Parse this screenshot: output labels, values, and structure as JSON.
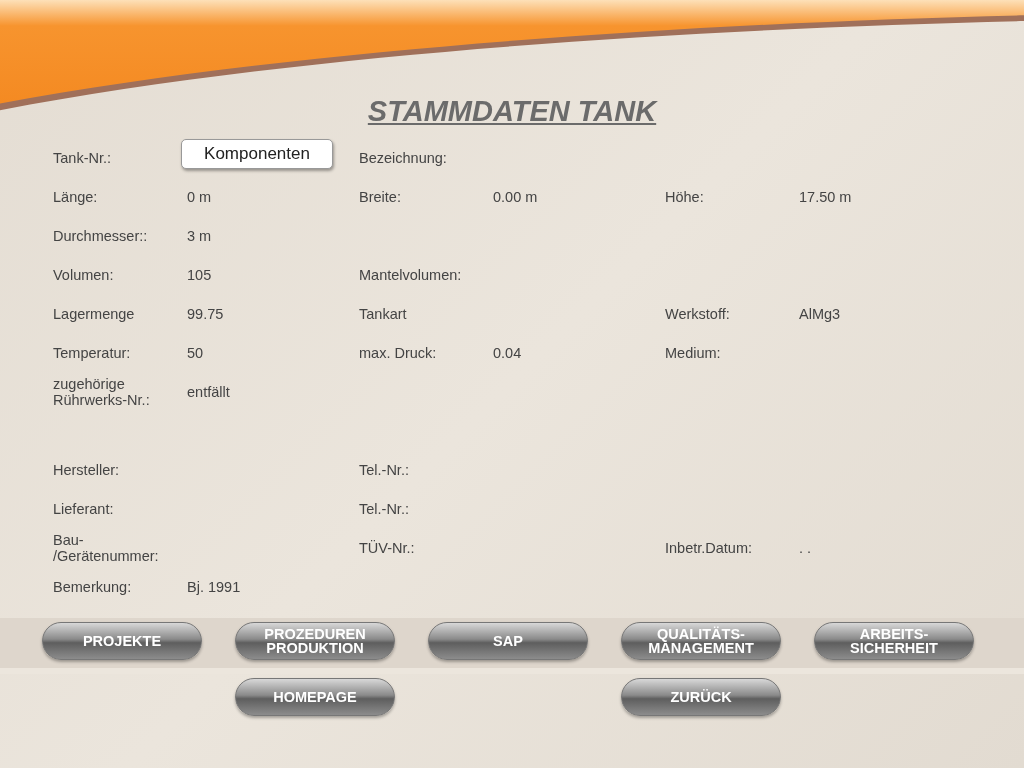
{
  "title": "STAMMDATEN TANK",
  "sections": [
    {
      "rows": [
        {
          "left": {
            "label": "Tank-Nr.:",
            "button": "Komponenten"
          },
          "middle": {
            "label": "Bezeichnung:"
          }
        },
        {
          "left": {
            "label": "Länge:",
            "value": "0 m"
          },
          "middle": {
            "label": "Breite:",
            "value": "0.00 m"
          },
          "right": {
            "label": "Höhe:",
            "value": "17.50 m"
          }
        },
        {
          "left": {
            "label": "Durchmesser::",
            "value": "3 m"
          }
        },
        {
          "left": {
            "label": "Volumen:",
            "value": "105"
          },
          "middle": {
            "label": "Mantelvolumen:"
          }
        },
        {
          "left": {
            "label": "Lagermenge",
            "value": "99.75"
          },
          "middle": {
            "label": "Tankart"
          },
          "right": {
            "label": "Werkstoff:",
            "value": "AlMg3"
          }
        },
        {
          "left": {
            "label": "Temperatur:",
            "value": "50"
          },
          "middle": {
            "label": "max. Druck:",
            "value": "0.04"
          },
          "right": {
            "label": "Medium:"
          }
        },
        {
          "left": {
            "label": "zugehörige Rührwerks-Nr.:",
            "value": "entfällt"
          }
        }
      ]
    },
    {
      "rows": [
        {
          "left": {
            "label": "Hersteller:"
          },
          "middle": {
            "label": "Tel.-Nr.:"
          }
        },
        {
          "left": {
            "label": "Lieferant:"
          },
          "middle": {
            "label": "Tel.-Nr.:"
          }
        },
        {
          "left": {
            "label": "Bau- /Gerätenummer:"
          },
          "middle": {
            "label": "TÜV-Nr.:"
          },
          "right": {
            "label": "Inbetr.Datum:",
            "value": ". ."
          }
        },
        {
          "left": {
            "label": "Bemerkung:",
            "value": "Bj. 1991"
          }
        }
      ]
    }
  ],
  "nav_buttons": [
    "PROJEKTE",
    "PROZEDUREN PRODUKTION",
    "SAP",
    "QUALITÄTS- MANAGEMENT",
    "ARBEITS- SICHERHEIT"
  ],
  "bottom_buttons": [
    "HOMEPAGE",
    "ZURÜCK"
  ]
}
